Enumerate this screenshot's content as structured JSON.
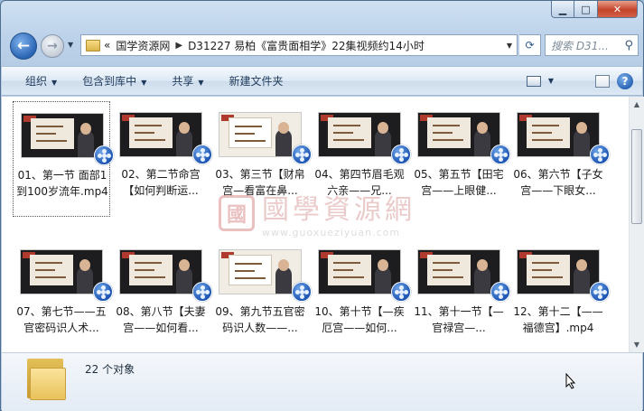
{
  "window": {
    "caption_buttons": [
      "minimize",
      "maximize",
      "close"
    ],
    "minimize_label": "▁",
    "maximize_label": "□",
    "close_label": "✕"
  },
  "nav": {
    "back_label": "←",
    "forward_label": "→",
    "breadcrumb": [
      "国学资源网",
      "D31227 易柏《富贵面相学》22集视频约14小时"
    ],
    "breadcrumb_prefix": "«",
    "refresh_label": "⟳",
    "search_placeholder": "搜索 D31..."
  },
  "toolbar": {
    "organize": "组织",
    "include_library": "包含到库中",
    "share": "共享",
    "new_folder": "新建文件夹",
    "help_label": "?"
  },
  "files": [
    {
      "label": "01、第一节 面部1到100岁流年.mp4",
      "selected": true,
      "light": false
    },
    {
      "label": "02、第二节命宫【如何判断运...",
      "selected": false,
      "light": false
    },
    {
      "label": "03、第三节【财帛宫—看富在鼻...",
      "selected": false,
      "light": true
    },
    {
      "label": "04、第四节眉毛观六亲——兄...",
      "selected": false,
      "light": false
    },
    {
      "label": "05、第五节【田宅宫——上眼健...",
      "selected": false,
      "light": false
    },
    {
      "label": "06、第六节【子女宫——下眼女...",
      "selected": false,
      "light": false
    },
    {
      "label": "07、第七节——五官密码识人术...",
      "selected": false,
      "light": false
    },
    {
      "label": "08、第八节【夫妻宫——如何看...",
      "selected": false,
      "light": false
    },
    {
      "label": "09、第九节五官密码识人数——...",
      "selected": false,
      "light": true
    },
    {
      "label": "10、第十节【—疾厄宫——如何...",
      "selected": false,
      "light": false
    },
    {
      "label": "11、第十一节【—官禄宫—...",
      "selected": false,
      "light": false
    },
    {
      "label": "12、第十二【——福德宫】.mp4",
      "selected": false,
      "light": false
    }
  ],
  "watermark": {
    "seal": "國",
    "text": "國學資源網",
    "url": "www.guoxueziyuan.com"
  },
  "status": {
    "count": "22 个对象"
  },
  "icons": [
    "back-arrow-icon",
    "forward-arrow-icon",
    "folder-icon",
    "refresh-icon",
    "search-icon",
    "view-icon",
    "help-icon",
    "media-player-icon"
  ]
}
